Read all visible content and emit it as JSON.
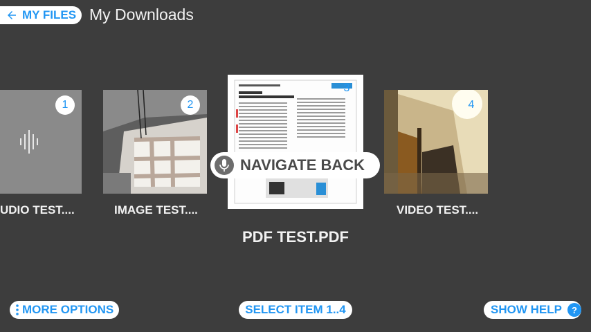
{
  "header": {
    "back_label": "MY FILES",
    "title": "My Downloads"
  },
  "items": [
    {
      "index": "1",
      "label": "UDIO TEST...."
    },
    {
      "index": "2",
      "label": "IMAGE TEST...."
    },
    {
      "index": "3",
      "label": "PDF TEST.PDF"
    },
    {
      "index": "4",
      "label": "VIDEO TEST...."
    }
  ],
  "voice_hint": {
    "label": "NAVIGATE BACK",
    "icon": "microphone-icon"
  },
  "footer": {
    "more_options": "MORE OPTIONS",
    "select_item": "SELECT ITEM 1..4",
    "show_help": "SHOW HELP",
    "help_icon": "?"
  },
  "colors": {
    "accent": "#2196f3",
    "background": "#3d3d3d"
  }
}
